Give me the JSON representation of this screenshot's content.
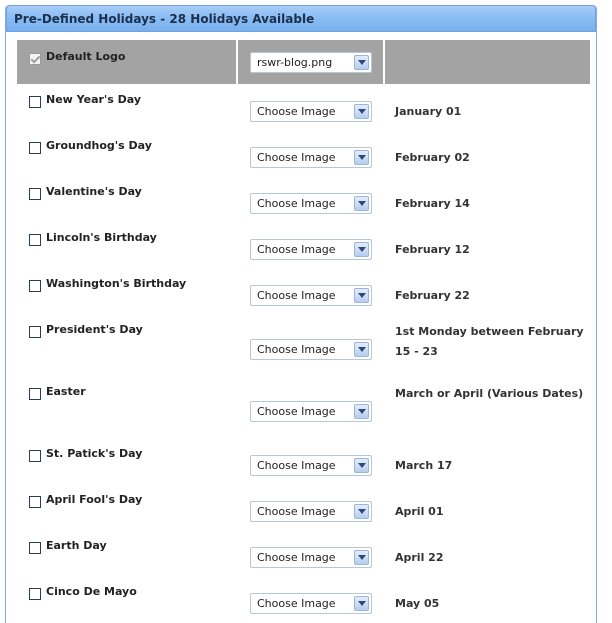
{
  "panel": {
    "title": "Pre-Defined Holidays - 28 Holidays Available"
  },
  "default_logo": {
    "label": "Default Logo",
    "checked": true,
    "select_value": "rswr-blog.png"
  },
  "holidays": [
    {
      "name": "New Year's Day",
      "image": "Choose Image",
      "date": "January 01"
    },
    {
      "name": "Groundhog's Day",
      "image": "Choose Image",
      "date": "February 02"
    },
    {
      "name": "Valentine's Day",
      "image": "Choose Image",
      "date": "February 14"
    },
    {
      "name": "Lincoln's Birthday",
      "image": "Choose Image",
      "date": "February 12"
    },
    {
      "name": "Washington's Birthday",
      "image": "Choose Image",
      "date": "February 22"
    },
    {
      "name": "President's Day",
      "image": "Choose Image",
      "date": "1st Monday between February 15 - 23"
    },
    {
      "name": "Easter",
      "image": "Choose Image",
      "date": "March or April (Various Dates)"
    },
    {
      "name": "St. Patick's Day",
      "image": "Choose Image",
      "date": "March 17"
    },
    {
      "name": "April Fool's Day",
      "image": "Choose Image",
      "date": "April 01"
    },
    {
      "name": "Earth Day",
      "image": "Choose Image",
      "date": "April 22"
    },
    {
      "name": "Cinco De Mayo",
      "image": "Choose Image",
      "date": "May 05"
    }
  ]
}
